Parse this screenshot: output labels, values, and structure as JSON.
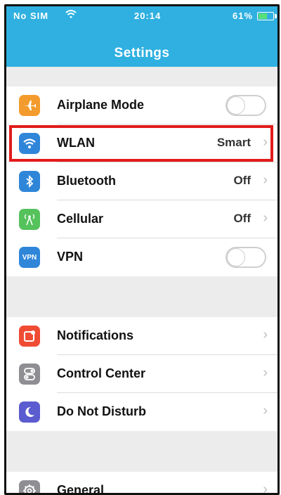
{
  "status_bar": {
    "carrier": "No SIM",
    "wifi_icon": "wifi-icon",
    "time": "20:14",
    "battery_percent": "61%",
    "battery_level": 0.61,
    "battery_color": "#58e07a"
  },
  "header": {
    "title": "Settings",
    "background": "#2fb0e0"
  },
  "groups": [
    {
      "items": [
        {
          "label": "Airplane Mode",
          "icon": "airplane-icon",
          "icon_color": "#f49b2e",
          "control": "toggle",
          "toggle_on": false
        },
        {
          "label": "WLAN",
          "icon": "wifi-icon",
          "icon_color": "#2f86d9",
          "value": "Smart",
          "control": "chevron",
          "highlighted": true
        },
        {
          "label": "Bluetooth",
          "icon": "bluetooth-icon",
          "icon_color": "#2f86d9",
          "value": "Off",
          "control": "chevron"
        },
        {
          "label": "Cellular",
          "icon": "cellular-antenna-icon",
          "icon_color": "#55c25c",
          "value": "Off",
          "control": "chevron"
        },
        {
          "label": "VPN",
          "icon": "vpn-icon",
          "icon_color": "#2f86d9",
          "icon_text": "VPN",
          "control": "toggle",
          "toggle_on": false
        }
      ]
    },
    {
      "items": [
        {
          "label": "Notifications",
          "icon": "notifications-icon",
          "icon_color": "#ef4c33",
          "control": "chevron"
        },
        {
          "label": "Control Center",
          "icon": "control-center-icon",
          "icon_color": "#8e8e93",
          "control": "chevron"
        },
        {
          "label": "Do Not Disturb",
          "icon": "moon-icon",
          "icon_color": "#5b5ccf",
          "control": "chevron"
        }
      ]
    },
    {
      "items": [
        {
          "label": "General",
          "icon": "gear-icon",
          "icon_color": "#8e8e93",
          "control": "chevron"
        }
      ]
    }
  ],
  "chevron_glyph": "›"
}
